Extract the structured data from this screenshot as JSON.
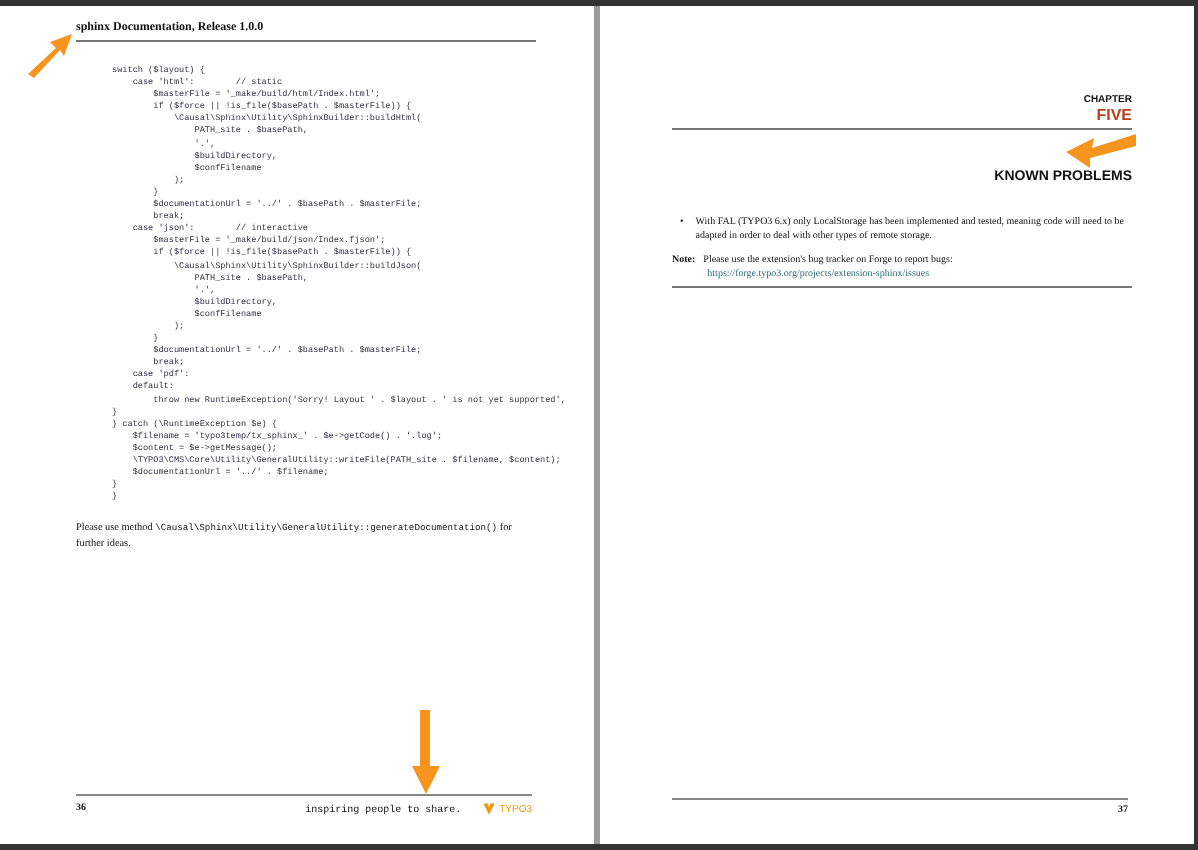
{
  "left_page": {
    "header": "sphinx Documentation, Release 1.0.0",
    "code_lines": [
      "switch ($layout) {",
      "    case 'html':        // static",
      "        $masterFile = '_make/build/html/Index.html';",
      "        if ($force || !is_file($basePath . $masterFile)) {",
      "            \\Causal\\Sphinx\\Utility\\SphinxBuilder::buildHtml(",
      "                PATH_site . $basePath,",
      "                '.',",
      "                $buildDirectory,",
      "                $confFilename",
      "            );",
      "        }",
      "        $documentationUrl = '../' . $basePath . $masterFile;",
      "        break;",
      "    case 'json':        // interactive",
      "        $masterFile = '_make/build/json/Index.fjson';",
      "        if ($force || !is_file($basePath . $masterFile)) {",
      "            \\Causal\\Sphinx\\Utility\\SphinxBuilder::buildJson(",
      "                PATH_site . $basePath,",
      "                '.',",
      "                $buildDirectory,",
      "                $confFilename",
      "            );",
      "        }",
      "        $documentationUrl = '../' . $basePath . $masterFile;",
      "        break;",
      "    case 'pdf':",
      "    default:",
      "        throw new RuntimeException('Sorry! Layout ' . $layout . ' is not yet supported',",
      "}",
      "} catch (\\RuntimeException $e) {",
      "    $filename = 'typo3temp/tx_sphinx_' . $e->getCode() . '.log';",
      "    $content = $e->getMessage();",
      "    \\TYPO3\\CMS\\Core\\Utility\\GeneralUtility::writeFile(PATH_site . $filename, $content);",
      "    $documentationUrl = '../' . $filename;",
      "}",
      "}"
    ],
    "paragraph": {
      "before": "Please use method ",
      "code": "\\Causal\\Sphinx\\Utility\\GeneralUtility::generateDocumentation()",
      "after": " for further ideas."
    },
    "footer": {
      "page_number": "36",
      "tagline": "inspiring people to share.",
      "logo": "TYPO3"
    }
  },
  "right_page": {
    "chapter_label": "CHAPTER",
    "chapter_number": "FIVE",
    "title": "KNOWN PROBLEMS",
    "bullets": [
      {
        "marker": "•",
        "text": "With FAL (TYPO3 6.x) only LocalStorage has been implemented and tested, meaning code will need to be adapted in order to deal with other types of remote storage."
      }
    ],
    "note": {
      "label": "Note:",
      "text": "Please use the extension's bug tracker on Forge to report bugs:",
      "link": "https://forge.typo3.org/projects/extension-sphinx/issues"
    },
    "footer": {
      "page_number": "37"
    }
  }
}
